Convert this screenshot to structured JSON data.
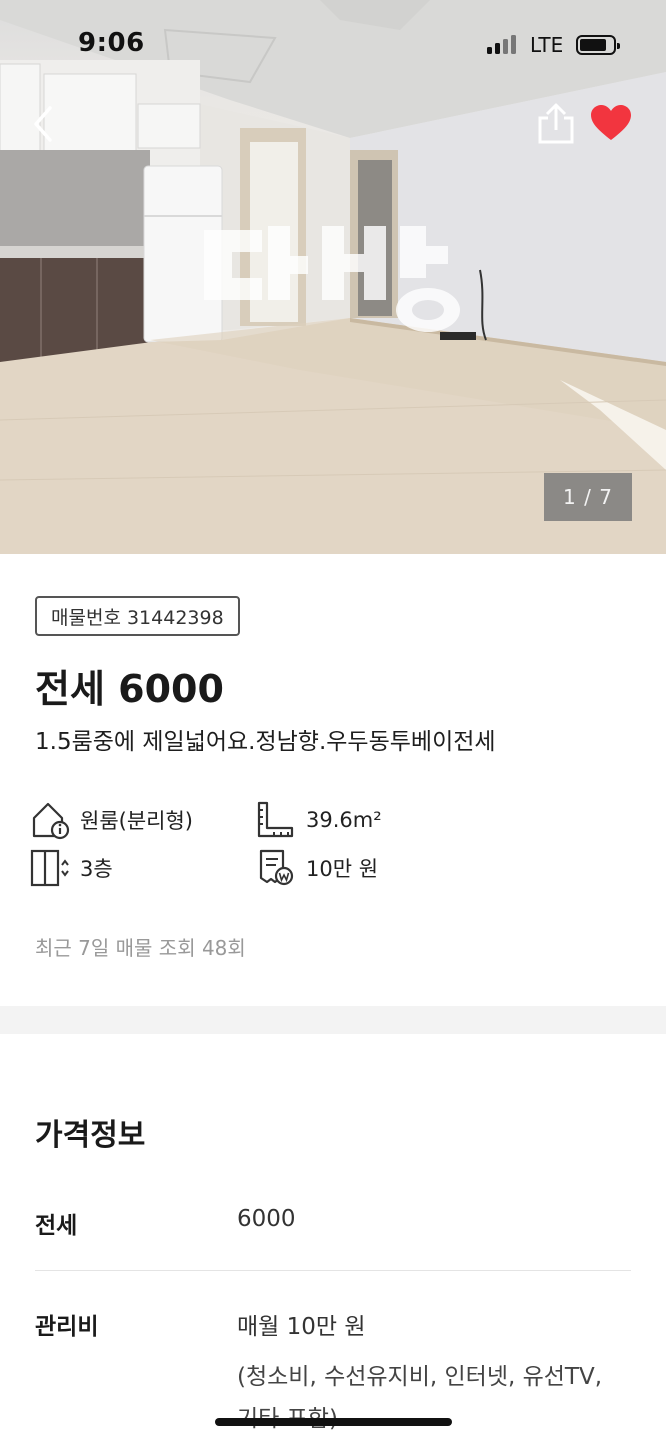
{
  "status_bar": {
    "time": "9:06",
    "network": "LTE"
  },
  "gallery": {
    "counter": "1 / 7",
    "watermark": "다방"
  },
  "listing": {
    "badge": "매물번호 31442398",
    "price_title": "전세 6000",
    "subtitle": "1.5룸중에 제일넓어요.정남향.우두동투베이전세",
    "specs": {
      "room_type": "원룸(분리형)",
      "area": "39.6m²",
      "floor": "3층",
      "maintenance": "10만 원"
    },
    "views": "최근 7일 매물 조회 48회"
  },
  "price_info": {
    "title": "가격정보",
    "rows": [
      {
        "label": "전세",
        "value": "6000"
      },
      {
        "label": "관리비",
        "value": "매월 10만 원",
        "note": "(청소비, 수선유지비, 인터넷, 유선TV, 기타 포함)"
      }
    ]
  },
  "icons": [
    "back-icon",
    "share-icon",
    "heart-icon",
    "house-info-icon",
    "ruler-area-icon",
    "floor-icon",
    "bill-icon"
  ],
  "colors": {
    "heart": "#f2353f",
    "counter_bg": "#787878",
    "badge_border": "#555555",
    "muted_text": "#999999"
  }
}
